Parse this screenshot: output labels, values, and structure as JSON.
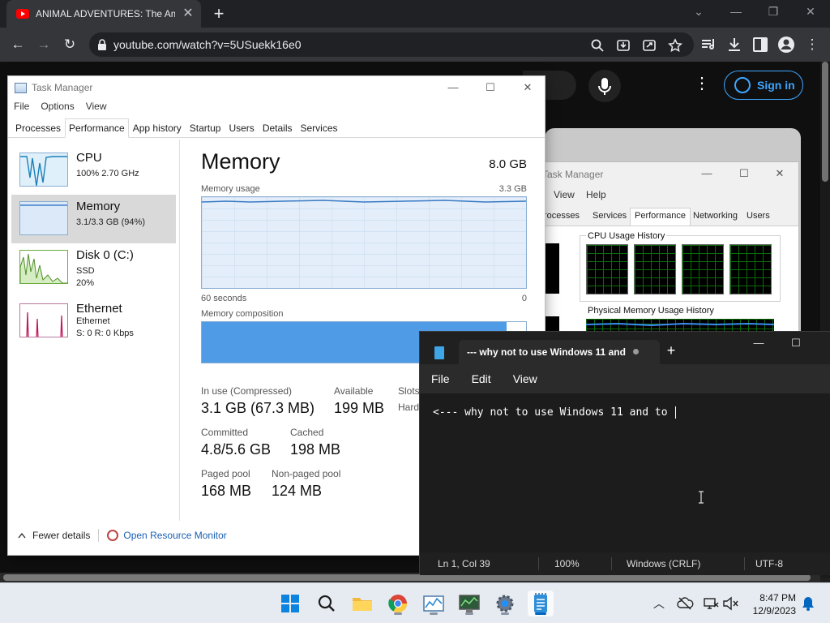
{
  "browser": {
    "tab_title": "ANIMAL ADVENTURES: The Ama",
    "tab_close": "✕",
    "new_tab": "+",
    "url": "youtube.com/watch?v=5USuekk16e0",
    "win_min": "⌄",
    "win_restore": "—",
    "win_max": "❐",
    "win_close": "✕",
    "back": "←",
    "forward": "→",
    "reload": "↻",
    "menu": "⋮"
  },
  "youtube": {
    "more": "⋮",
    "sign_in": "Sign in"
  },
  "task_manager": {
    "title": "Task Manager",
    "win_min": "—",
    "win_max": "☐",
    "win_close": "✕",
    "menu": [
      "File",
      "Options",
      "View"
    ],
    "tabs": [
      "Processes",
      "Performance",
      "App history",
      "Startup",
      "Users",
      "Details",
      "Services"
    ],
    "active_tab": "Performance",
    "sidebar": [
      {
        "name": "CPU",
        "sub1": "100% 2.70 GHz"
      },
      {
        "name": "Memory",
        "sub1": "3.1/3.3 GB (94%)"
      },
      {
        "name": "Disk 0 (C:)",
        "sub1": "SSD",
        "sub2": "20%"
      },
      {
        "name": "Ethernet",
        "sub1": "Ethernet",
        "sub2": "S: 0 R: 0 Kbps"
      }
    ],
    "memory": {
      "title": "Memory",
      "total": "8.0 GB",
      "usage_label": "Memory usage",
      "usage_max": "3.3 GB",
      "time_span": "60 seconds",
      "time_end": "0",
      "composition_label": "Memory composition",
      "composition_used_fraction": 0.94,
      "in_use_label": "In use (Compressed)",
      "in_use_value": "3.1 GB (67.3 MB)",
      "available_label": "Available",
      "available_value": "199 MB",
      "slots_label": "Slots",
      "hardware_label": "Hardw",
      "committed_label": "Committed",
      "committed_value": "4.8/5.6 GB",
      "cached_label": "Cached",
      "cached_value": "198 MB",
      "paged_label": "Paged pool",
      "paged_value": "168 MB",
      "nonpaged_label": "Non-paged pool",
      "nonpaged_value": "124 MB"
    },
    "footer": {
      "fewer_details": "Fewer details",
      "resource_monitor": "Open Resource Monitor"
    }
  },
  "task_manager_classic": {
    "title": "Task Manager",
    "win_min": "—",
    "win_max": "☐",
    "win_close": "✕",
    "menu": [
      "View",
      "Help"
    ],
    "tabs": [
      "rocesses",
      "Services",
      "Performance",
      "Networking",
      "Users"
    ],
    "cpu_history_label": "CPU Usage History",
    "physical_memory_label": "Physical Memory Usage History"
  },
  "notepad": {
    "tab_title": "--- why not to use Windows 11 and",
    "new_tab": "+",
    "win_min": "—",
    "win_max": "☐",
    "win_close": "✕",
    "menu": [
      "File",
      "Edit",
      "View"
    ],
    "text": "<--- why not to use Windows 11 and to ",
    "status": {
      "position": "Ln 1, Col 39",
      "zoom": "100%",
      "line_ending": "Windows (CRLF)",
      "encoding": "UTF-8"
    }
  },
  "taskbar": {
    "time": "8:47 PM",
    "date": "12/9/2023",
    "chevron": "︿"
  }
}
